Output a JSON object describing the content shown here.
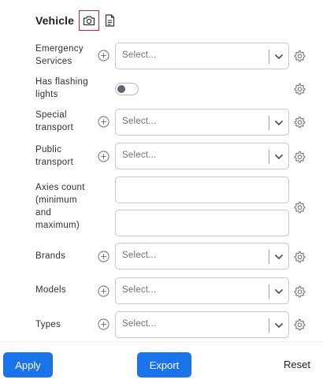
{
  "section": {
    "title": "Vehicle",
    "camera_icon": "camera-icon",
    "document_icon": "document-icon"
  },
  "fields": {
    "emergency_services": {
      "label_line1": "Emergency",
      "label_line2": "Services",
      "placeholder": "Select..."
    },
    "has_flashing_lights": {
      "label_line1": "Has flashing",
      "label_line2": "lights",
      "enabled": false
    },
    "special_transport": {
      "label_line1": "Special",
      "label_line2": "transport",
      "placeholder": "Select..."
    },
    "public_transport": {
      "label_line1": "Public",
      "label_line2": "transport",
      "placeholder": "Select..."
    },
    "axles_count": {
      "label_line1": "Axies count",
      "label_line2": "(minimum",
      "label_line3": "and",
      "label_line4": "maximum)",
      "min_value": "",
      "max_value": ""
    },
    "brands": {
      "label": "Brands",
      "placeholder": "Select..."
    },
    "models": {
      "label": "Models",
      "placeholder": "Select..."
    },
    "types": {
      "label": "Types",
      "placeholder": "Select..."
    }
  },
  "footer": {
    "apply_label": "Apply",
    "export_label": "Export",
    "reset_label": "Reset"
  },
  "colors": {
    "primary": "#1a73e8",
    "highlight_border": "#e0202a"
  }
}
